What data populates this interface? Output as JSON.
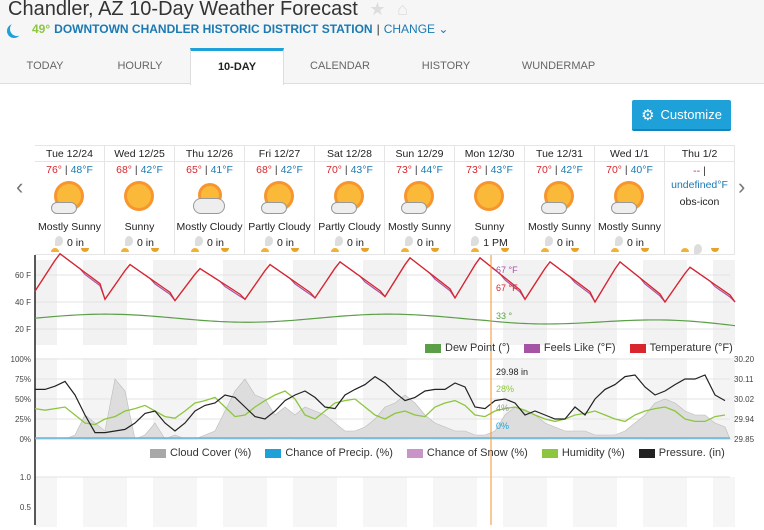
{
  "header": {
    "title": "Chandler, AZ 10-Day Weather Forecast",
    "current_temp": "49°",
    "station": "DOWNTOWN CHANDLER HISTORIC DISTRICT STATION",
    "separator": "|",
    "change_label": "CHANGE"
  },
  "tabs": [
    {
      "label": "TODAY"
    },
    {
      "label": "HOURLY"
    },
    {
      "label": "10-DAY",
      "active": true
    },
    {
      "label": "CALENDAR"
    },
    {
      "label": "HISTORY"
    },
    {
      "label": "WUNDERMAP"
    }
  ],
  "customize_label": "Customize",
  "days": [
    {
      "date": "Tue 12/24",
      "hi": "76°",
      "lo": "48°F",
      "cond": "Mostly Sunny",
      "precip": "0 in",
      "icon": "mostly-sunny"
    },
    {
      "date": "Wed 12/25",
      "hi": "68°",
      "lo": "42°F",
      "cond": "Sunny",
      "precip": "0 in",
      "icon": "sunny"
    },
    {
      "date": "Thu 12/26",
      "hi": "65°",
      "lo": "41°F",
      "cond": "Mostly Cloudy",
      "precip": "0 in",
      "icon": "mostly-cloudy"
    },
    {
      "date": "Fri 12/27",
      "hi": "68°",
      "lo": "42°F",
      "cond": "Partly Cloudy",
      "precip": "0 in",
      "icon": "partly-cloudy"
    },
    {
      "date": "Sat 12/28",
      "hi": "70°",
      "lo": "43°F",
      "cond": "Partly Cloudy",
      "precip": "0 in",
      "icon": "partly-cloudy"
    },
    {
      "date": "Sun 12/29",
      "hi": "73°",
      "lo": "44°F",
      "cond": "Mostly Sunny",
      "precip": "0 in",
      "icon": "mostly-sunny"
    },
    {
      "date": "Mon 12/30",
      "hi": "73°",
      "lo": "43°F",
      "cond": "Sunny",
      "precip": "1 PM",
      "icon": "sunny"
    },
    {
      "date": "Tue 12/31",
      "hi": "70°",
      "lo": "42°F",
      "cond": "Mostly Sunny",
      "precip": "0 in",
      "icon": "mostly-sunny"
    },
    {
      "date": "Wed 1/1",
      "hi": "70°",
      "lo": "40°F",
      "cond": "Mostly Sunny",
      "precip": "0 in",
      "icon": "mostly-sunny"
    },
    {
      "date": "Thu 1/2",
      "hi": "--",
      "lo": "undefined°F",
      "cond": "obs-icon",
      "precip": "",
      "icon": "none"
    }
  ],
  "temp_chart": {
    "y_ticks": [
      "60 F",
      "40 F",
      "20 F"
    ],
    "hover": {
      "feels_like": "67 °F",
      "temperature": "67 °F",
      "dew_point": "33 °"
    },
    "legend": [
      {
        "label": "Dew Point (°)",
        "color": "#5b9e48"
      },
      {
        "label": "Feels Like (°F)",
        "color": "#a653a6"
      },
      {
        "label": "Temperature (°F)",
        "color": "#d9262c"
      }
    ]
  },
  "cond_chart": {
    "y_ticks_left": [
      "100%",
      "75%",
      "50%",
      "25%",
      "0%"
    ],
    "y_ticks_right": [
      "30.20",
      "30.11",
      "30.02",
      "29.94",
      "29.85"
    ],
    "hover": {
      "pressure": "29.98 in",
      "humidity": "28%",
      "cloud": "4%",
      "precip": "0%"
    },
    "legend": [
      {
        "label": "Cloud Cover (%)",
        "color": "#a8a8a8"
      },
      {
        "label": "Chance of Precip. (%)",
        "color": "#1ea1d8"
      },
      {
        "label": "Chance of Snow (%)",
        "color": "#c994c7"
      },
      {
        "label": "Humidity (%)",
        "color": "#8cc63f"
      },
      {
        "label": "Pressure. (in)",
        "color": "#222222"
      }
    ]
  },
  "precip_chart": {
    "y_ticks": [
      "1.0",
      "0.5"
    ]
  }
}
